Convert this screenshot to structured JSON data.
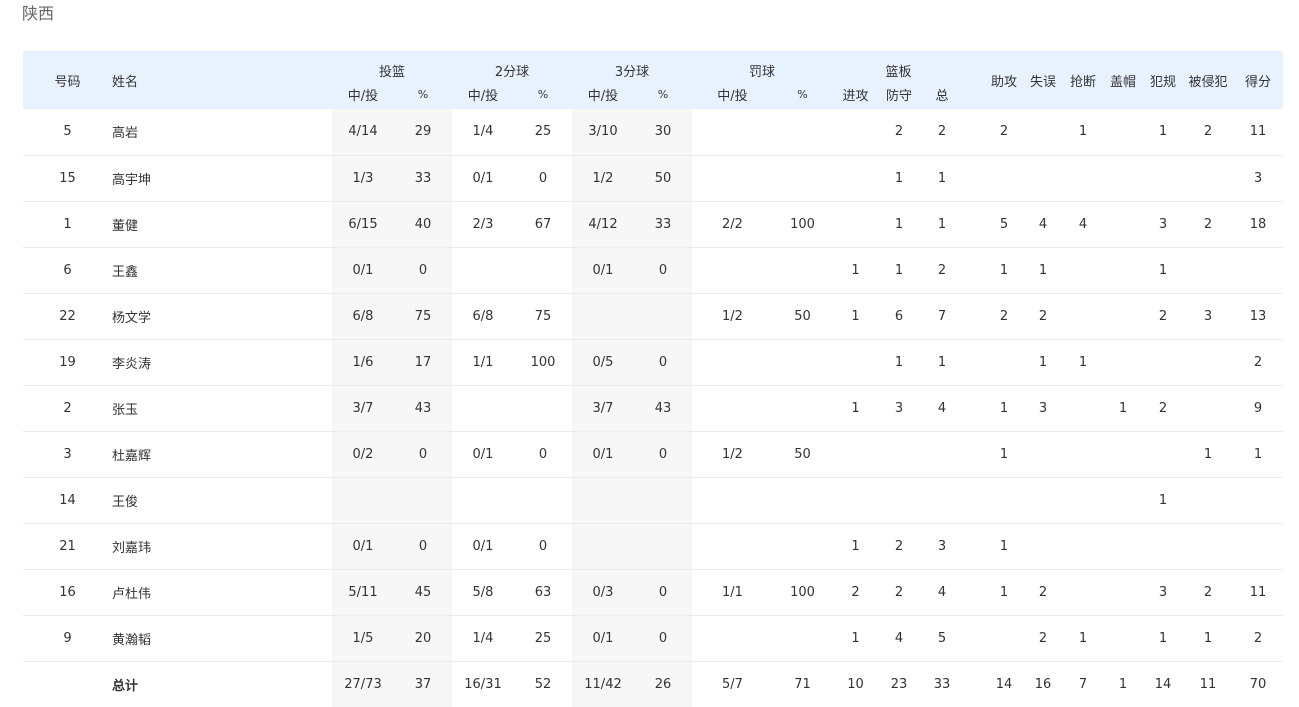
{
  "team": {
    "name": "陕西"
  },
  "headers": {
    "number": "号码",
    "name": "姓名",
    "fg": "投篮",
    "two": "2分球",
    "three": "3分球",
    "ft": "罚球",
    "reb": "篮板",
    "made_att": "中/投",
    "pct": "%",
    "off": "进攻",
    "def": "防守",
    "tot": "总",
    "ast": "助攻",
    "tov": "失误",
    "stl": "抢断",
    "blk": "盖帽",
    "pf": "犯规",
    "fd": "被侵犯",
    "pts": "得分"
  },
  "players": [
    {
      "num": "5",
      "name": "高岩",
      "fg": "4/14",
      "fg_pct": "29",
      "two": "1/4",
      "two_pct": "25",
      "three": "3/10",
      "three_pct": "30",
      "ft": "",
      "ft_pct": "",
      "oreb": "",
      "dreb": "2",
      "treb": "2",
      "ast": "2",
      "tov": "",
      "stl": "1",
      "blk": "",
      "pf": "1",
      "fd": "2",
      "pts": "11"
    },
    {
      "num": "15",
      "name": "高宇坤",
      "fg": "1/3",
      "fg_pct": "33",
      "two": "0/1",
      "two_pct": "0",
      "three": "1/2",
      "three_pct": "50",
      "ft": "",
      "ft_pct": "",
      "oreb": "",
      "dreb": "1",
      "treb": "1",
      "ast": "",
      "tov": "",
      "stl": "",
      "blk": "",
      "pf": "",
      "fd": "",
      "pts": "3"
    },
    {
      "num": "1",
      "name": "董健",
      "fg": "6/15",
      "fg_pct": "40",
      "two": "2/3",
      "two_pct": "67",
      "three": "4/12",
      "three_pct": "33",
      "ft": "2/2",
      "ft_pct": "100",
      "oreb": "",
      "dreb": "1",
      "treb": "1",
      "ast": "5",
      "tov": "4",
      "stl": "4",
      "blk": "",
      "pf": "3",
      "fd": "2",
      "pts": "18"
    },
    {
      "num": "6",
      "name": "王鑫",
      "fg": "0/1",
      "fg_pct": "0",
      "two": "",
      "two_pct": "",
      "three": "0/1",
      "three_pct": "0",
      "ft": "",
      "ft_pct": "",
      "oreb": "1",
      "dreb": "1",
      "treb": "2",
      "ast": "1",
      "tov": "1",
      "stl": "",
      "blk": "",
      "pf": "1",
      "fd": "",
      "pts": ""
    },
    {
      "num": "22",
      "name": "杨文学",
      "fg": "6/8",
      "fg_pct": "75",
      "two": "6/8",
      "two_pct": "75",
      "three": "",
      "three_pct": "",
      "ft": "1/2",
      "ft_pct": "50",
      "oreb": "1",
      "dreb": "6",
      "treb": "7",
      "ast": "2",
      "tov": "2",
      "stl": "",
      "blk": "",
      "pf": "2",
      "fd": "3",
      "pts": "13"
    },
    {
      "num": "19",
      "name": "李炎涛",
      "fg": "1/6",
      "fg_pct": "17",
      "two": "1/1",
      "two_pct": "100",
      "three": "0/5",
      "three_pct": "0",
      "ft": "",
      "ft_pct": "",
      "oreb": "",
      "dreb": "1",
      "treb": "1",
      "ast": "",
      "tov": "1",
      "stl": "1",
      "blk": "",
      "pf": "",
      "fd": "",
      "pts": "2"
    },
    {
      "num": "2",
      "name": "张玉",
      "fg": "3/7",
      "fg_pct": "43",
      "two": "",
      "two_pct": "",
      "three": "3/7",
      "three_pct": "43",
      "ft": "",
      "ft_pct": "",
      "oreb": "1",
      "dreb": "3",
      "treb": "4",
      "ast": "1",
      "tov": "3",
      "stl": "",
      "blk": "1",
      "pf": "2",
      "fd": "",
      "pts": "9"
    },
    {
      "num": "3",
      "name": "杜嘉辉",
      "fg": "0/2",
      "fg_pct": "0",
      "two": "0/1",
      "two_pct": "0",
      "three": "0/1",
      "three_pct": "0",
      "ft": "1/2",
      "ft_pct": "50",
      "oreb": "",
      "dreb": "",
      "treb": "",
      "ast": "1",
      "tov": "",
      "stl": "",
      "blk": "",
      "pf": "",
      "fd": "1",
      "pts": "1"
    },
    {
      "num": "14",
      "name": "王俊",
      "fg": "",
      "fg_pct": "",
      "two": "",
      "two_pct": "",
      "three": "",
      "three_pct": "",
      "ft": "",
      "ft_pct": "",
      "oreb": "",
      "dreb": "",
      "treb": "",
      "ast": "",
      "tov": "",
      "stl": "",
      "blk": "",
      "pf": "1",
      "fd": "",
      "pts": ""
    },
    {
      "num": "21",
      "name": "刘嘉玮",
      "fg": "0/1",
      "fg_pct": "0",
      "two": "0/1",
      "two_pct": "0",
      "three": "",
      "three_pct": "",
      "ft": "",
      "ft_pct": "",
      "oreb": "1",
      "dreb": "2",
      "treb": "3",
      "ast": "1",
      "tov": "",
      "stl": "",
      "blk": "",
      "pf": "",
      "fd": "",
      "pts": ""
    },
    {
      "num": "16",
      "name": "卢杜伟",
      "fg": "5/11",
      "fg_pct": "45",
      "two": "5/8",
      "two_pct": "63",
      "three": "0/3",
      "three_pct": "0",
      "ft": "1/1",
      "ft_pct": "100",
      "oreb": "2",
      "dreb": "2",
      "treb": "4",
      "ast": "1",
      "tov": "2",
      "stl": "",
      "blk": "",
      "pf": "3",
      "fd": "2",
      "pts": "11"
    },
    {
      "num": "9",
      "name": "黄瀚韬",
      "fg": "1/5",
      "fg_pct": "20",
      "two": "1/4",
      "two_pct": "25",
      "three": "0/1",
      "three_pct": "0",
      "ft": "",
      "ft_pct": "",
      "oreb": "1",
      "dreb": "4",
      "treb": "5",
      "ast": "",
      "tov": "2",
      "stl": "1",
      "blk": "",
      "pf": "1",
      "fd": "1",
      "pts": "2"
    }
  ],
  "total": {
    "num": "",
    "name": "总计",
    "fg": "27/73",
    "fg_pct": "37",
    "two": "16/31",
    "two_pct": "52",
    "three": "11/42",
    "three_pct": "26",
    "ft": "5/7",
    "ft_pct": "71",
    "oreb": "10",
    "dreb": "23",
    "treb": "33",
    "ast": "14",
    "tov": "16",
    "stl": "7",
    "blk": "1",
    "pf": "14",
    "fd": "11",
    "pts": "70"
  }
}
